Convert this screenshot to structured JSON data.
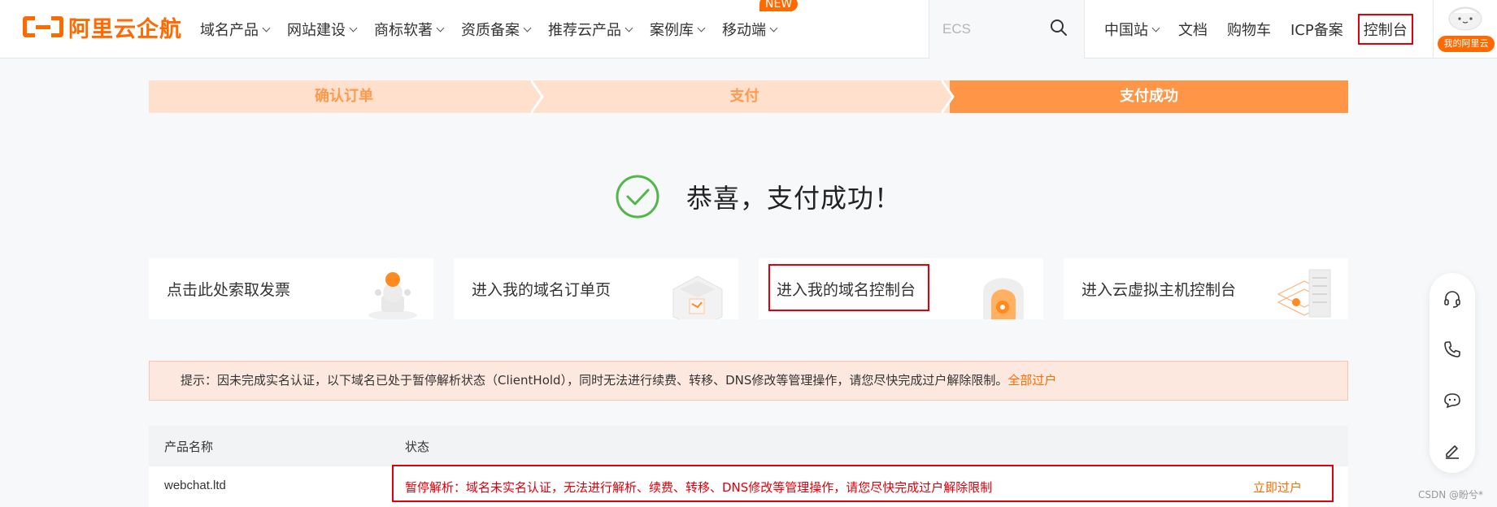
{
  "brand": {
    "logo_text": "阿里云企航",
    "accent": "#ff6a00"
  },
  "nav": {
    "items": [
      {
        "label": "域名产品",
        "dropdown": true
      },
      {
        "label": "网站建设",
        "dropdown": true
      },
      {
        "label": "商标软著",
        "dropdown": true
      },
      {
        "label": "资质备案",
        "dropdown": true
      },
      {
        "label": "推荐云产品",
        "dropdown": true
      },
      {
        "label": "案例库",
        "dropdown": true
      },
      {
        "label": "移动端",
        "dropdown": true,
        "badge": "NEW"
      }
    ]
  },
  "search": {
    "placeholder": "ECS",
    "icon": "search-icon"
  },
  "right_nav": {
    "region": "中国站",
    "docs": "文档",
    "cart": "购物车",
    "icp": "ICP备案",
    "console": "控制台",
    "my_aliyun": "我的阿里云"
  },
  "steps": [
    {
      "label": "确认订单",
      "state": "done"
    },
    {
      "label": "支付",
      "state": "done"
    },
    {
      "label": "支付成功",
      "state": "active"
    }
  ],
  "success": {
    "title": "恭喜，支付成功！",
    "icon": "check-circle-icon"
  },
  "cards": [
    {
      "label": "点击此处索取发票",
      "icon": "invoice-illustration"
    },
    {
      "label": "进入我的域名订单页",
      "icon": "order-illustration"
    },
    {
      "label": "进入我的域名控制台",
      "icon": "domain-console-illustration",
      "highlighted": true
    },
    {
      "label": "进入云虚拟主机控制台",
      "icon": "server-illustration"
    }
  ],
  "notice": {
    "text": "提示：因未完成实名认证，以下域名已处于暂停解析状态（ClientHold），同时无法进行续费、转移、DNS修改等管理操作，请您尽快完成过户解除限制。",
    "link": "全部过户"
  },
  "table": {
    "columns": [
      "产品名称",
      "状态"
    ],
    "rows": [
      {
        "name": "webchat.ltd",
        "status": "暂停解析：域名未实名认证，无法进行解析、续费、转移、DNS修改等管理操作，请您尽快完成过户解除限制",
        "action": "立即过户"
      }
    ]
  },
  "float_toolbar": [
    "headset-icon",
    "phone-icon",
    "chat-bot-icon",
    "edit-icon"
  ],
  "watermark": "CSDN @盼兮*"
}
